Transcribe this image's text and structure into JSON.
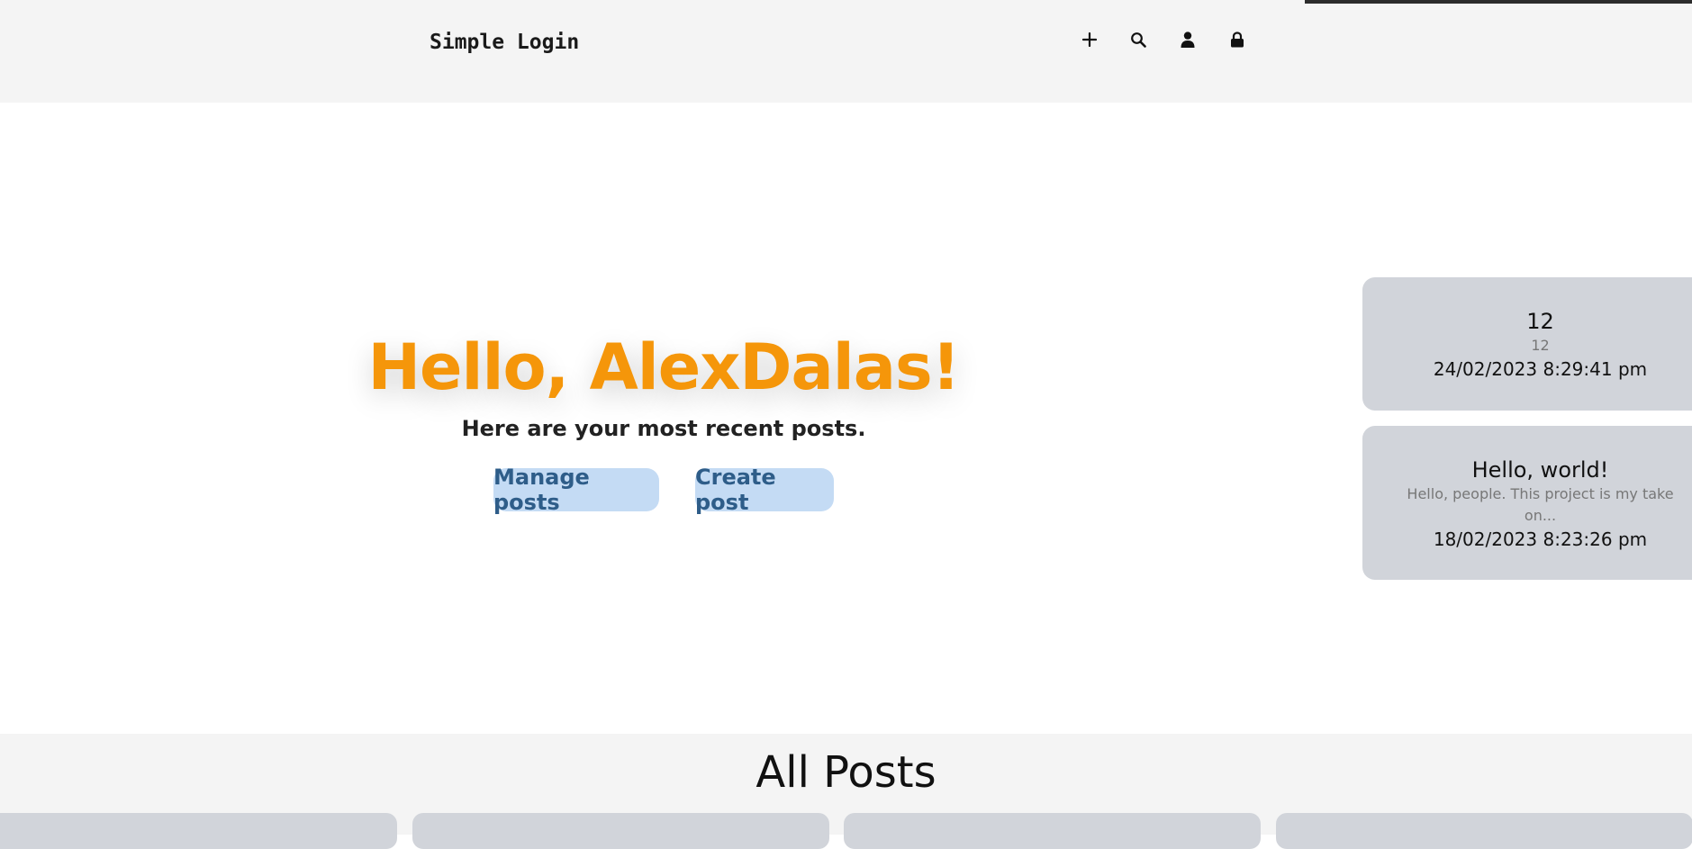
{
  "header": {
    "brand": "Simple Login",
    "nav_icons": [
      "plus-icon",
      "search-icon",
      "user-icon",
      "lock-icon"
    ]
  },
  "hero": {
    "greeting": "Hello, AlexDalas!",
    "subtitle": "Here are your most recent posts.",
    "manage_label": "Manage posts",
    "create_label": "Create post"
  },
  "recent_posts": [
    {
      "title": "12",
      "excerpt": "12",
      "date": "24/02/2023 8:29:41 pm"
    },
    {
      "title": "Hello, world!",
      "excerpt": "Hello, people.   This project is my take on...",
      "date": "18/02/2023 8:23:26 pm"
    }
  ],
  "all_posts": {
    "heading": "All Posts"
  },
  "colors": {
    "accent": "#f5960a",
    "pill_bg": "#c4dbf4",
    "pill_text": "#2e5d89",
    "card_bg": "#d1d4da",
    "header_bg": "#f4f4f4"
  }
}
